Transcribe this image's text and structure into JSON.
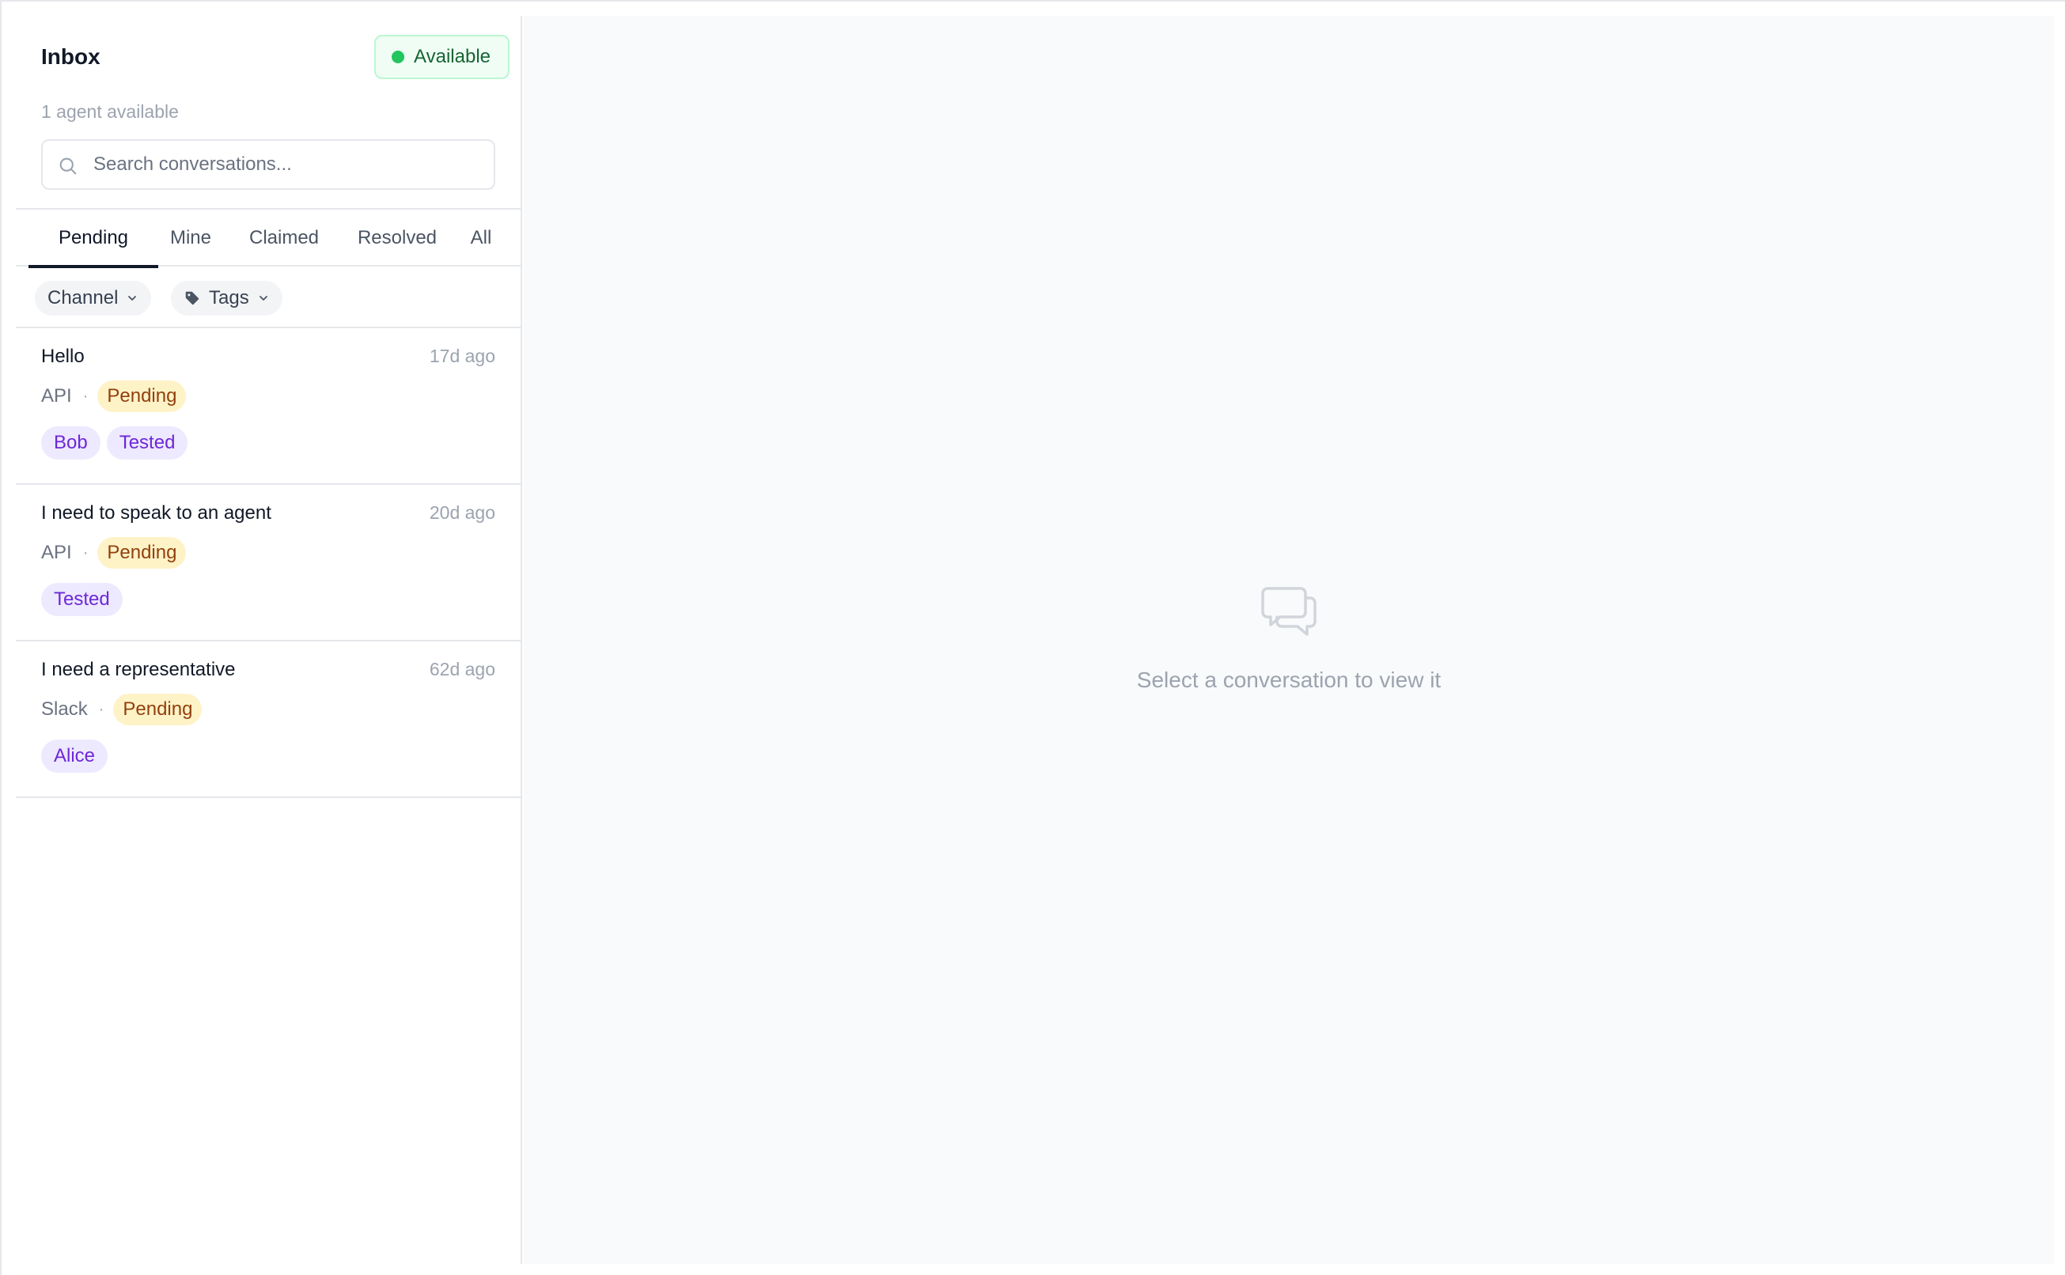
{
  "header": {
    "title": "Inbox",
    "status_label": "Available",
    "status_color": "#22c55e",
    "agents_available": "1 agent available"
  },
  "search": {
    "placeholder": "Search conversations...",
    "value": ""
  },
  "tabs": [
    {
      "label": "Pending",
      "active": true
    },
    {
      "label": "Mine",
      "active": false
    },
    {
      "label": "Claimed",
      "active": false
    },
    {
      "label": "Resolved",
      "active": false
    },
    {
      "label": "All",
      "active": false
    }
  ],
  "filters": {
    "channel_label": "Channel",
    "tags_label": "Tags"
  },
  "conversations": [
    {
      "title": "Hello",
      "time": "17d ago",
      "channel": "API",
      "separator": "·",
      "status": "Pending",
      "tags": [
        "Bob",
        "Tested"
      ]
    },
    {
      "title": "I need to speak to an agent",
      "time": "20d ago",
      "channel": "API",
      "separator": "·",
      "status": "Pending",
      "tags": [
        "Tested"
      ]
    },
    {
      "title": "I need a representative",
      "time": "62d ago",
      "channel": "Slack",
      "separator": "·",
      "status": "Pending",
      "tags": [
        "Alice"
      ]
    }
  ],
  "empty_state": {
    "icon": "chat-bubbles-icon",
    "message": "Select a conversation to view it"
  },
  "colors": {
    "accent": "#111827",
    "pending_bg": "#fef3c7",
    "pending_text": "#92400e",
    "tag_bg": "#ede9fe",
    "tag_text": "#6d28d9",
    "available_bg": "#f0fdf4"
  }
}
